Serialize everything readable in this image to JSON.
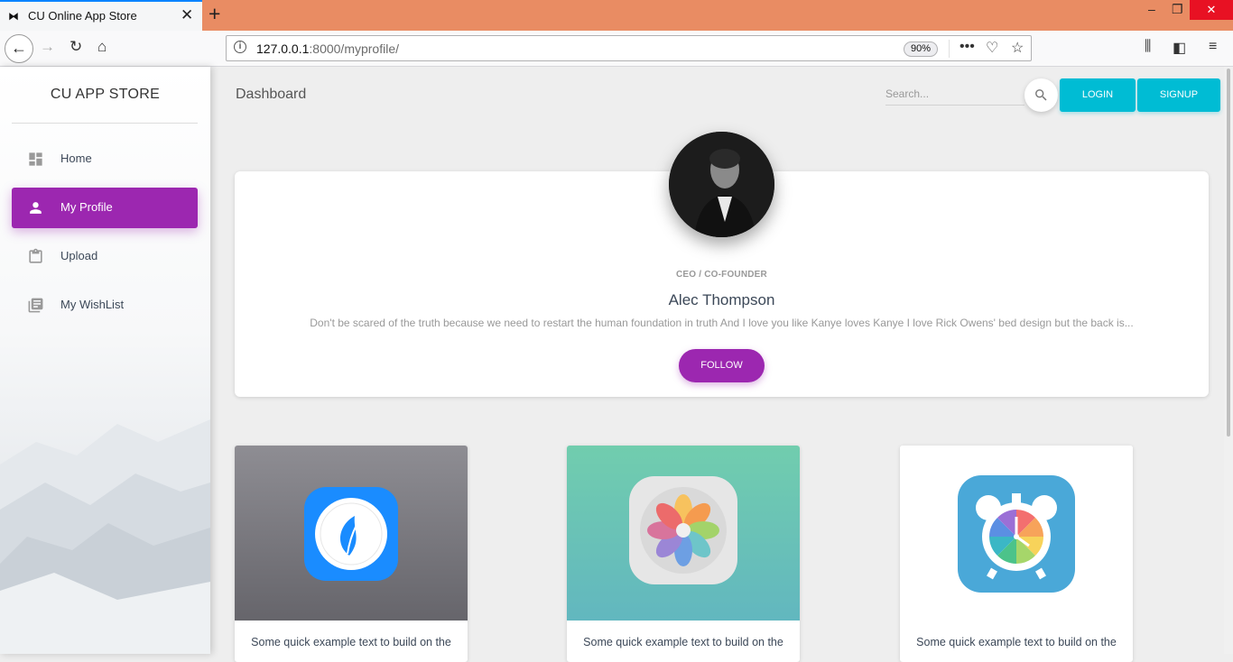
{
  "browser": {
    "tab_title": "CU Online App Store",
    "new_tab": "+",
    "url_host": "127.0.0.1",
    "url_rest": ":8000/myprofile/",
    "zoom": "90%"
  },
  "sidebar": {
    "brand": "CU APP STORE",
    "items": [
      {
        "label": "Home",
        "icon": "dashboard-icon",
        "active": false
      },
      {
        "label": "My Profile",
        "icon": "person-icon",
        "active": true
      },
      {
        "label": "Upload",
        "icon": "clipboard-icon",
        "active": false
      },
      {
        "label": "My WishList",
        "icon": "library-books-icon",
        "active": false
      }
    ]
  },
  "header": {
    "title": "Dashboard",
    "search_placeholder": "Search...",
    "login": "LOGIN",
    "signup": "SIGNUP"
  },
  "profile": {
    "role": "CEO / CO-FOUNDER",
    "name": "Alec Thompson",
    "bio": "Don't be scared of the truth because we need to restart the human foundation in truth And I love you like Kanye loves Kanye I love Rick Owens' bed design but the back is...",
    "follow": "FOLLOW"
  },
  "apps": [
    {
      "text": "Some quick example text to build on the",
      "icon": "leaf-app-icon"
    },
    {
      "text": "Some quick example text to build on the",
      "icon": "photos-app-icon"
    },
    {
      "text": "Some quick example text to build on the",
      "icon": "alarm-clock-app-icon"
    }
  ],
  "colors": {
    "primary": "#9c27b0",
    "accent": "#00bcd4",
    "titlebar": "#e98c63"
  }
}
